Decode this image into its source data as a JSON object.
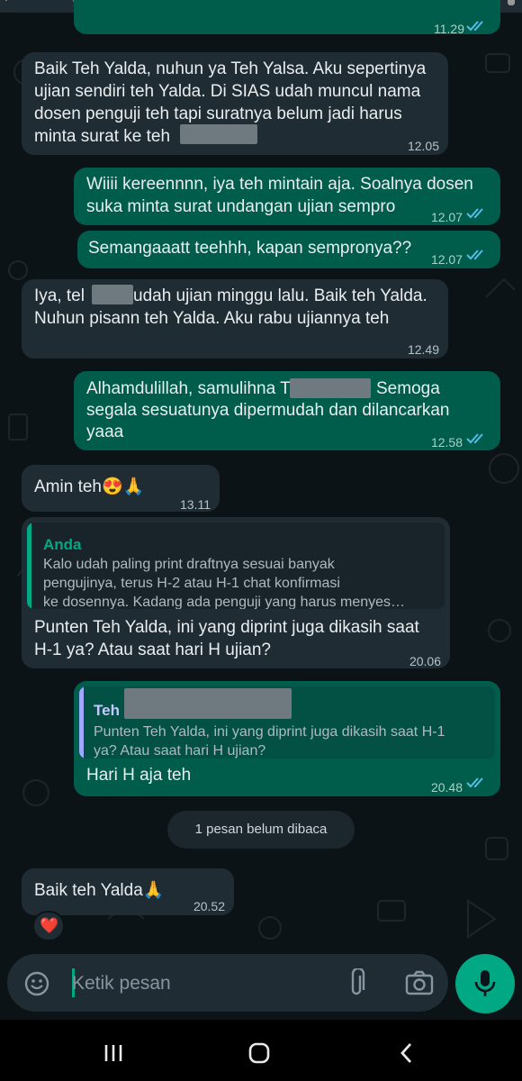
{
  "colors": {
    "background": "#0c1317",
    "incoming_bubble": "#1f2c34",
    "outgoing_bubble": "#005c4b",
    "accent_green": "#00a884",
    "read_ticks": "#53bdeb",
    "quote_name_anda": "#00a884",
    "quote_name_teh": "#9fa8ff"
  },
  "top": {
    "partial_time": "11.29"
  },
  "messages": [
    {
      "direction": "in",
      "lines": [
        "Baik Teh Yalda, nuhun ya Teh Yalsa. Aku sepertinya",
        "ujian sendiri teh Yalda. Di SIAS udah muncul nama",
        "dosen penguji teh tapi suratnya belum jadi harus",
        "minta surat ke teh"
      ],
      "time": "12.05"
    },
    {
      "direction": "out",
      "lines": [
        "Wiiii kereennnn, iya teh mintain aja. Soalnya dosen",
        "suka minta surat undangan ujian sempro"
      ],
      "time": "12.07"
    },
    {
      "direction": "out",
      "lines": [
        "Semangaaatt teehhh, kapan sempronya??"
      ],
      "time": "12.07"
    },
    {
      "direction": "in",
      "lines": [
        "Iya, tel",
        "udah ujian minggu lalu. Baik teh Yalda.",
        "Nuhun pisann teh Yalda. Aku rabu ujiannya teh"
      ],
      "time": "12.49"
    },
    {
      "direction": "out",
      "lines": [
        "Alhamdulillah, samulihna T",
        "Semoga",
        "segala sesuatunya dipermudah dan dilancarkan",
        "yaaa"
      ],
      "time": "12.58"
    },
    {
      "direction": "in",
      "lines": [
        "Amin teh😍🙏"
      ],
      "time": "13.11"
    },
    {
      "direction": "in",
      "quote": {
        "name": "Anda",
        "lines": [
          "Kalo udah paling print draftnya sesuai banyak",
          "pengujinya, terus H-2 atau H-1 chat konfirmasi",
          "ke dosennya. Kadang ada penguji yang harus menyes…"
        ]
      },
      "lines": [
        "Punten Teh Yalda, ini yang diprint juga dikasih saat",
        "H-1 ya? Atau saat hari H ujian?"
      ],
      "time": "20.06"
    },
    {
      "direction": "out",
      "quote": {
        "name": "Teh",
        "lines": [
          "Punten Teh Yalda, ini yang diprint juga dikasih saat H-1",
          "ya? Atau saat hari H ujian?"
        ]
      },
      "lines": [
        "Hari H aja teh"
      ],
      "time": "20.48"
    },
    {
      "direction": "in",
      "lines": [
        "Baik teh Yalda🙏"
      ],
      "time": "20.52",
      "reaction": "❤️"
    }
  ],
  "unread_label": "1 pesan belum dibaca",
  "composer": {
    "placeholder": "Ketik pesan",
    "emoji_icon": "emoji-icon",
    "attach_icon": "paperclip-icon",
    "camera_icon": "camera-icon",
    "mic_icon": "mic-icon"
  },
  "navbar": {
    "icons": [
      "recent-apps-icon",
      "home-icon",
      "back-icon"
    ]
  }
}
